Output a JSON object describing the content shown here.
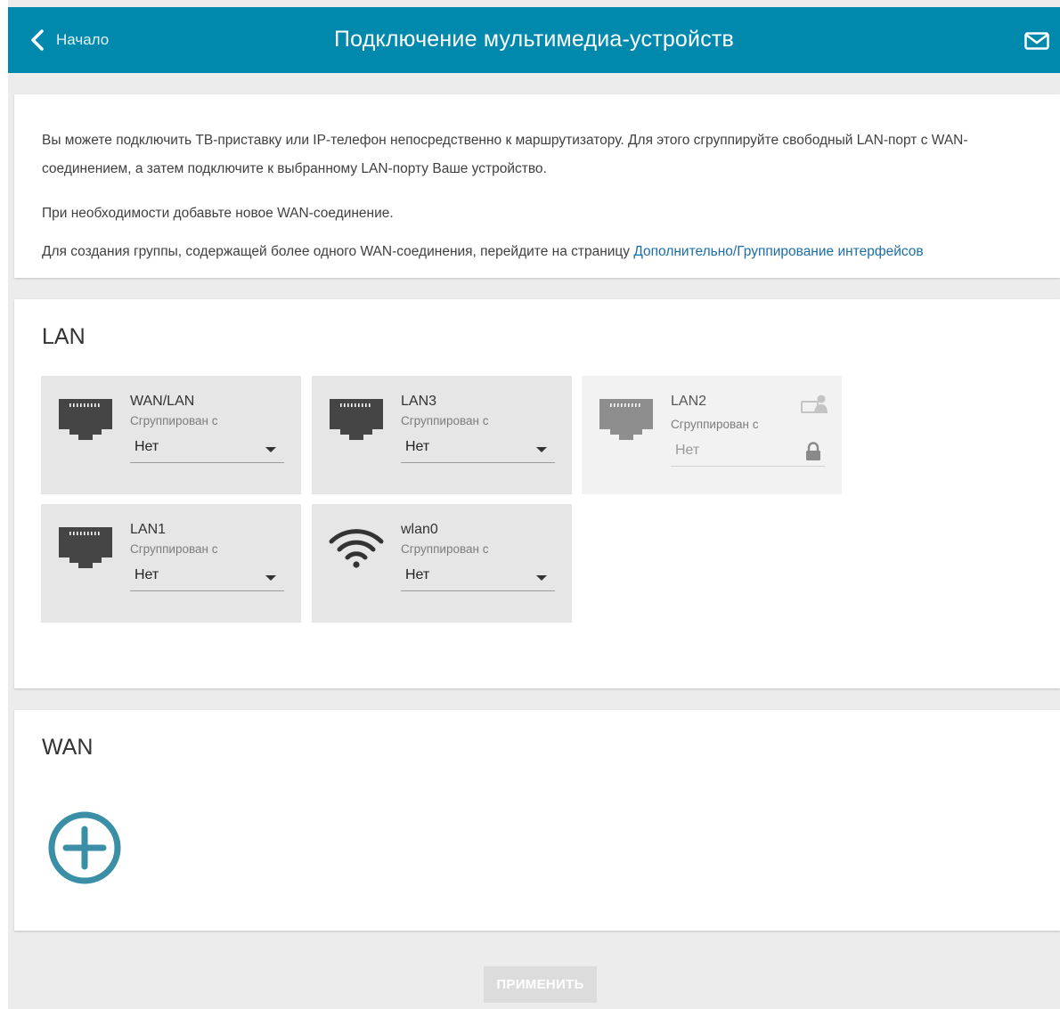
{
  "header": {
    "back_label": "Начало",
    "title": "Подключение мультимедиа-устройств",
    "bg_color": "#0089ad"
  },
  "info": {
    "line1": "Вы можете подключить ТВ-приставку или IP-телефон непосредственно к маршрутизатору. Для этого сгруппируйте свободный LAN-порт с WAN-соединением, а затем подключите к выбранному LAN-порту Ваше устройство.",
    "line2": "При необходимости добавьте новое WAN-соединение.",
    "line3_text": "Для создания группы, содержащей более одного WAN-соединения, перейдите на страницу ",
    "line3_link": "Дополнительно/Группирование интерфейсов"
  },
  "lan": {
    "title": "LAN",
    "ports": [
      {
        "name": "WAN/LAN",
        "sub": "Сгруппирован с",
        "value": "Нет",
        "icon": "ethernet-port-icon",
        "disabled": false
      },
      {
        "name": "LAN3",
        "sub": "Сгруппирован с",
        "value": "Нет",
        "icon": "ethernet-port-icon",
        "disabled": false
      },
      {
        "name": "LAN2",
        "sub": "Сгруппирован с",
        "value": "Нет",
        "icon": "ethernet-port-icon",
        "disabled": true
      },
      {
        "name": "LAN1",
        "sub": "Сгруппирован с",
        "value": "Нет",
        "icon": "ethernet-port-icon",
        "disabled": false
      },
      {
        "name": "wlan0",
        "sub": "Сгруппирован с",
        "value": "Нет",
        "icon": "wifi-icon",
        "disabled": false
      }
    ]
  },
  "wan": {
    "title": "WAN",
    "add_icon": "plus-circle-icon",
    "accent_color": "#3a8fa6"
  },
  "apply_label": "ПРИМЕНИТЬ"
}
